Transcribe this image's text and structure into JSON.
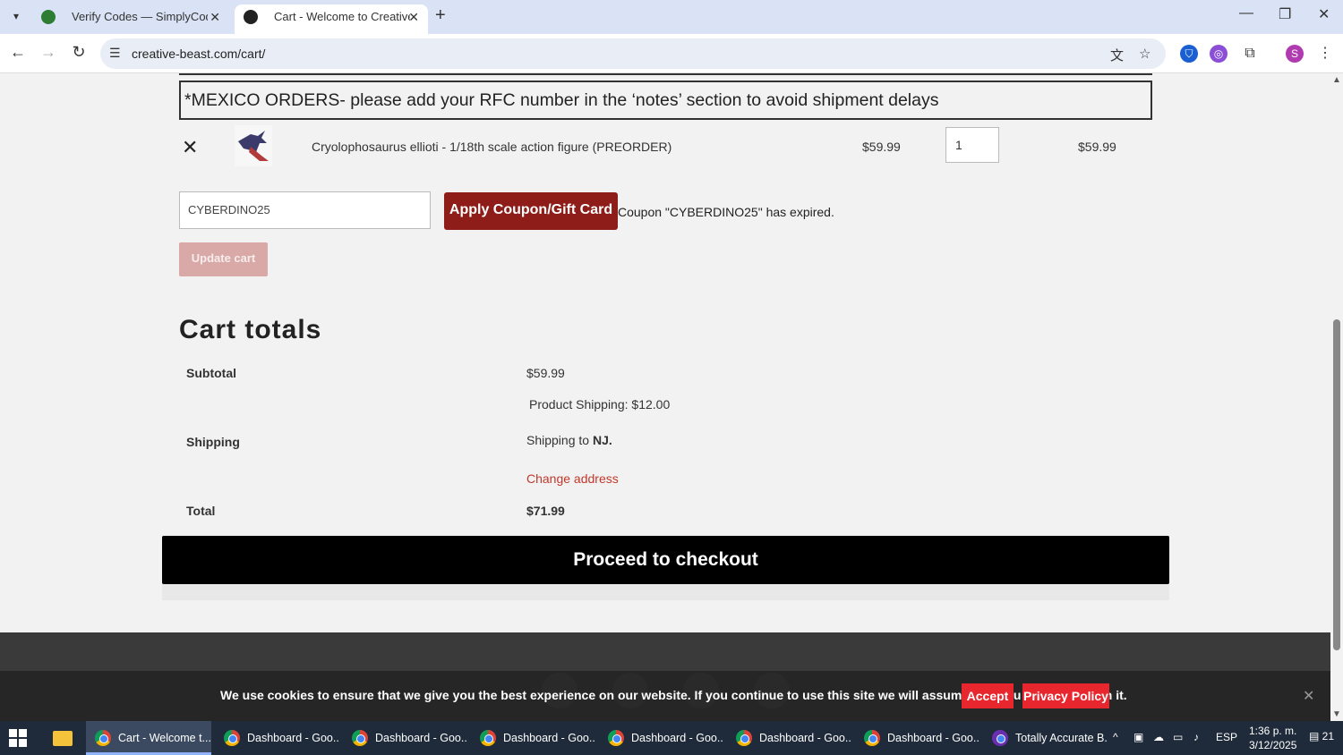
{
  "browser": {
    "tabs": [
      {
        "title": "Verify Codes — SimplyCodes"
      },
      {
        "title": "Cart - Welcome to Creative Beast"
      }
    ],
    "url": "creative-beast.com/cart/"
  },
  "cart": {
    "notice": "*MEXICO ORDERS- please add your RFC number in the ‘notes’ section to avoid shipment delays",
    "item": {
      "name": "Cryolophosaurus ellioti - 1/18th scale action figure (PREORDER)",
      "price": "$59.99",
      "quantity": "1",
      "total": "$59.99"
    },
    "coupon_code": "CYBERDINO25",
    "apply_label": "Apply Coupon/Gift Card",
    "coupon_message": "Coupon \"CYBERDINO25\" has expired.",
    "update_label": "Update cart"
  },
  "totals": {
    "title": "Cart totals",
    "subtotal_label": "Subtotal",
    "subtotal_value": "$59.99",
    "product_shipping": "Product Shipping: $12.00",
    "shipping_label": "Shipping",
    "shipping_to": "Shipping to",
    "shipping_dest": "NJ.",
    "change_address": "Change address",
    "total_label": "Total",
    "total_value": "$71.99",
    "checkout_label": "Proceed to checkout"
  },
  "cookie": {
    "text": "We use cookies to ensure that we give you the best experience on our website. If you continue to use this site we will assume that you are happy with it.",
    "accept": "Accept",
    "privacy": "Privacy Policy"
  },
  "taskbar": {
    "tasks": [
      "Cart - Welcome t...",
      "Dashboard - Goo...",
      "Dashboard - Goo...",
      "Dashboard - Goo...",
      "Dashboard - Goo...",
      "Dashboard - Goo...",
      "Dashboard - Goo...",
      "Totally Accurate B..."
    ],
    "lang": "ESP",
    "time": "1:36 p. m.",
    "date": "3/12/2025",
    "notifications": "21"
  },
  "colors": {
    "apply_button": "#8e1d1a",
    "change_address": "#c0392b",
    "cookie_buttons": "#e8262d"
  }
}
